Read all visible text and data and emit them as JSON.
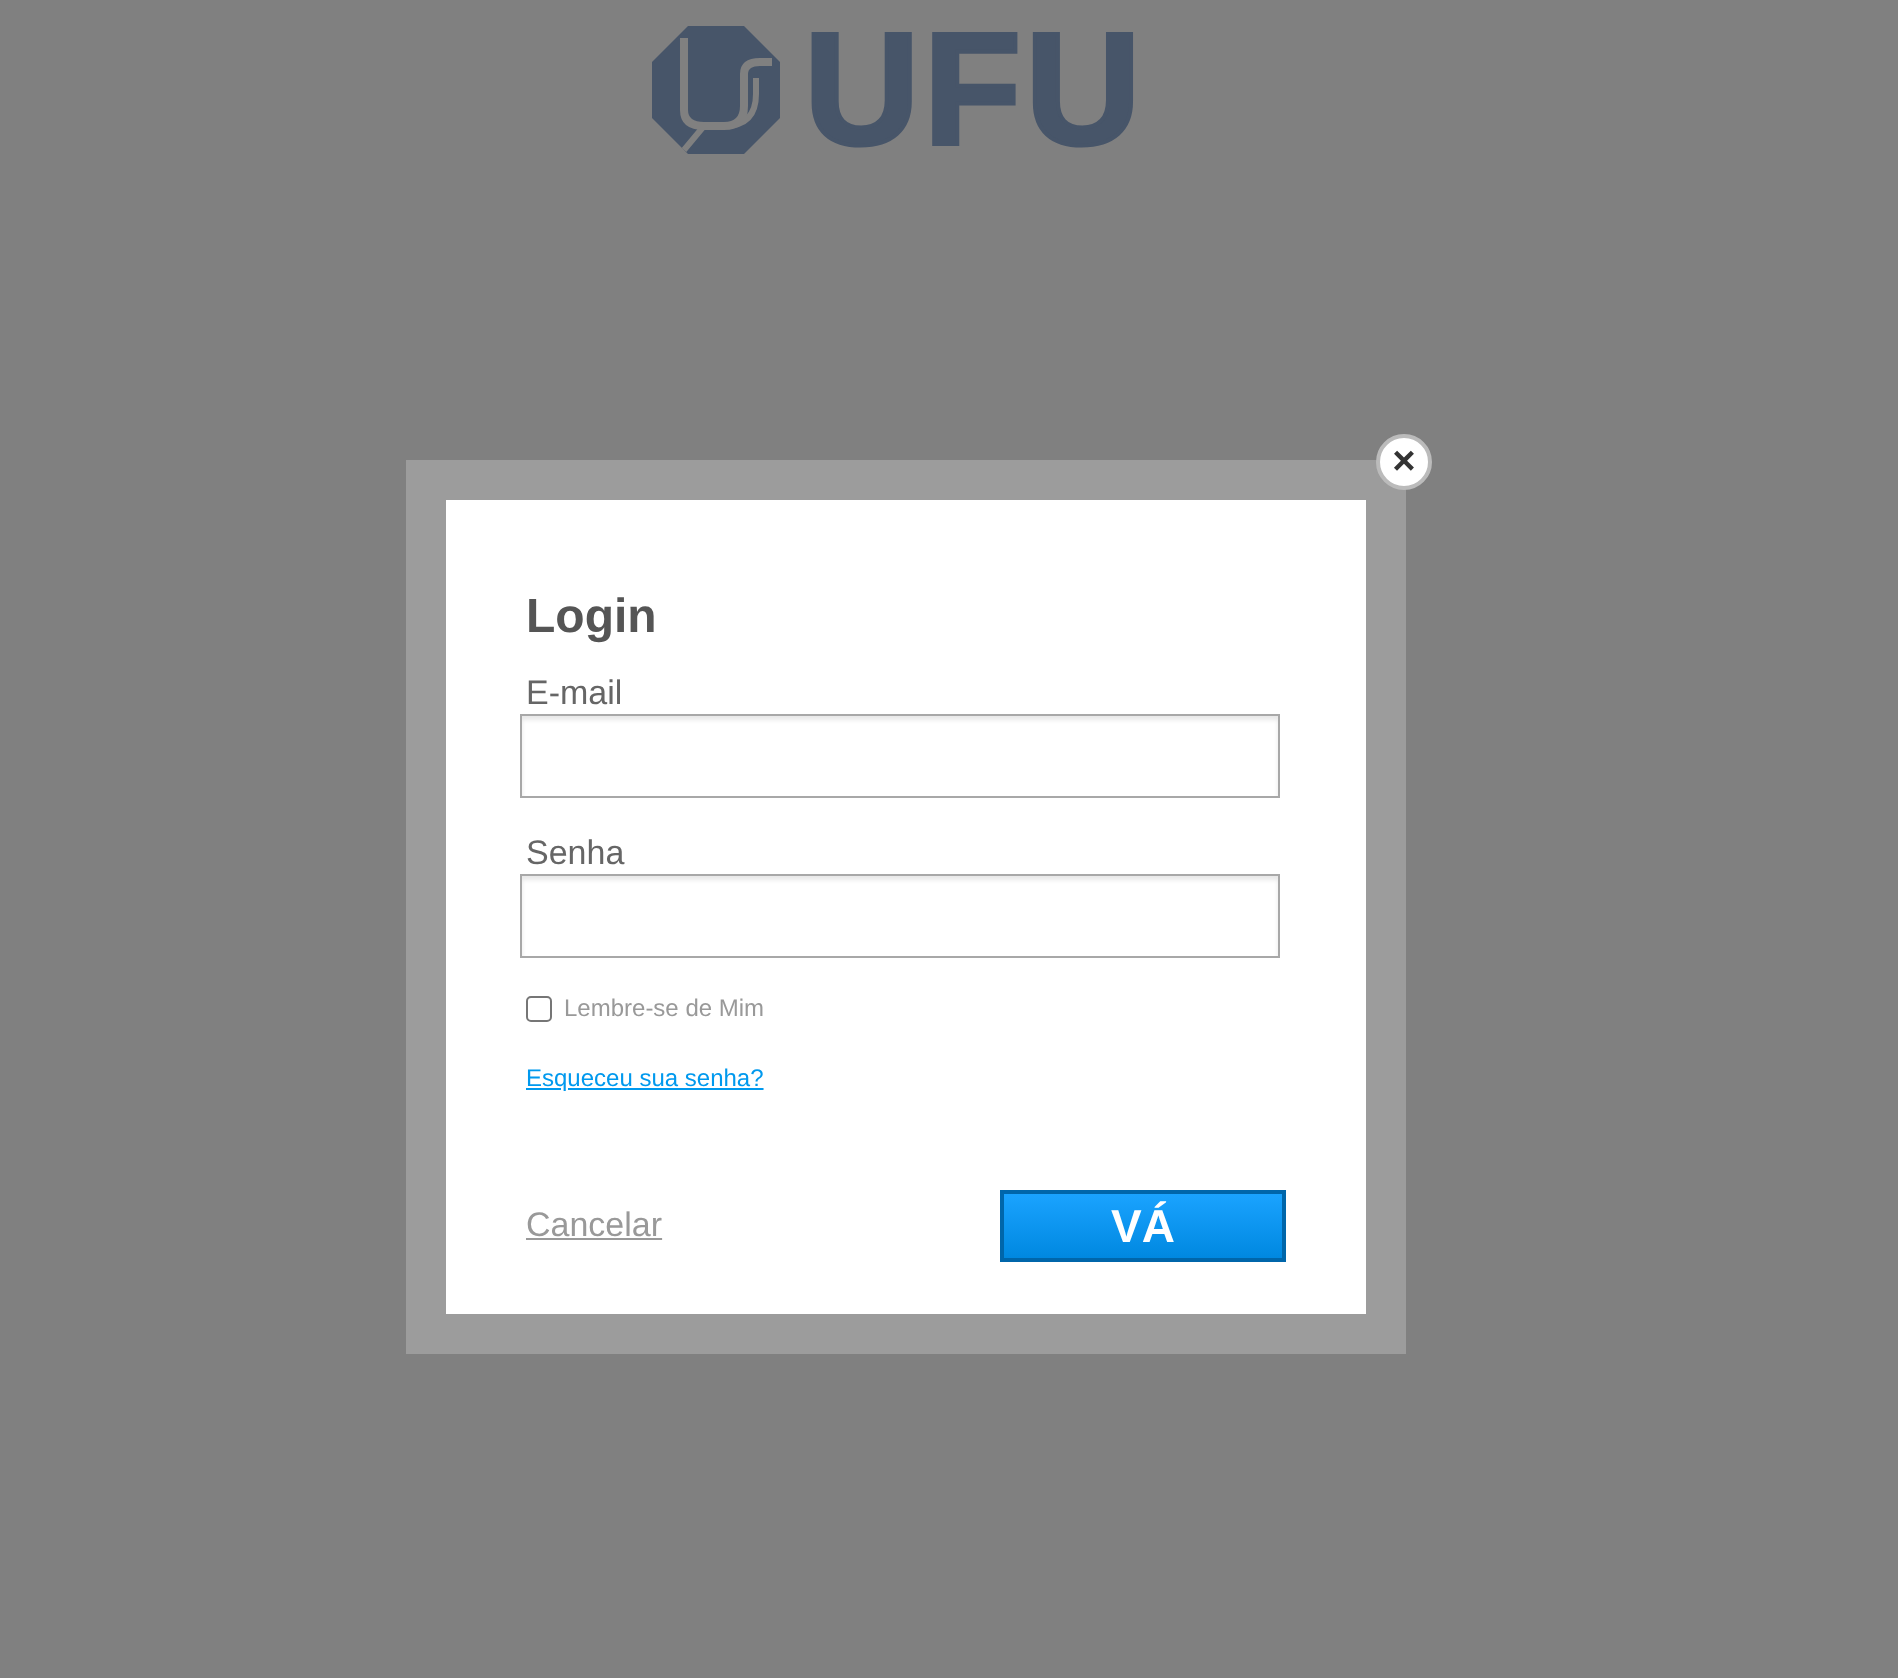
{
  "logo": {
    "text": "UFU"
  },
  "dialog": {
    "close": "×",
    "title": "Login",
    "fields": [
      {
        "label": "E-mail"
      },
      {
        "label": "Senha"
      }
    ],
    "remember": {
      "label": "Lembre-se de Mim",
      "checked": false
    },
    "forgot_link": "Esqueceu sua senha?",
    "cancel": "Cancelar",
    "submit": "VÁ"
  }
}
